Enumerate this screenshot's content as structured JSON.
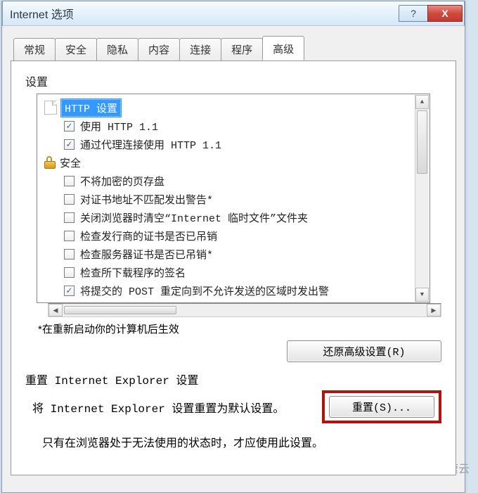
{
  "window": {
    "title": "Internet 选项"
  },
  "titlebar_buttons": {
    "help": "?",
    "close": "X"
  },
  "tabs": [
    {
      "label": "常规"
    },
    {
      "label": "安全"
    },
    {
      "label": "隐私"
    },
    {
      "label": "内容"
    },
    {
      "label": "连接"
    },
    {
      "label": "程序"
    },
    {
      "label": "高级",
      "active": true
    }
  ],
  "section": {
    "settings_label": "设置"
  },
  "tree": {
    "items": [
      {
        "kind": "category",
        "icon": "file-icon",
        "label": "HTTP 设置",
        "selected": true
      },
      {
        "kind": "check",
        "checked": true,
        "label": "使用 HTTP 1.1"
      },
      {
        "kind": "check",
        "checked": true,
        "label": "通过代理连接使用 HTTP 1.1"
      },
      {
        "kind": "category",
        "icon": "lock-icon",
        "label": "安全"
      },
      {
        "kind": "check",
        "checked": false,
        "label": "不将加密的页存盘"
      },
      {
        "kind": "check",
        "checked": false,
        "label": "对证书地址不匹配发出警告*"
      },
      {
        "kind": "check",
        "checked": false,
        "label": "关闭浏览器时清空“Internet 临时文件”文件夹"
      },
      {
        "kind": "check",
        "checked": false,
        "label": "检查发行商的证书是否已吊销"
      },
      {
        "kind": "check",
        "checked": false,
        "label": "检查服务器证书是否已吊销*"
      },
      {
        "kind": "check",
        "checked": false,
        "label": "检查所下载程序的签名"
      },
      {
        "kind": "check",
        "checked": true,
        "label": "将提交的 POST 重定向到不允许发送的区域时发出警"
      }
    ]
  },
  "note": "*在重新启动你的计算机后生效",
  "restore_button": "还原高级设置(R)",
  "reset": {
    "heading": "重置 Internet Explorer 设置",
    "desc": "将 Internet Explorer 设置重置为默认设置。",
    "button": "重置(S)..."
  },
  "hint": "只有在浏览器处于无法使用的状态时，才应使用此设置。",
  "watermark": "亿速云"
}
